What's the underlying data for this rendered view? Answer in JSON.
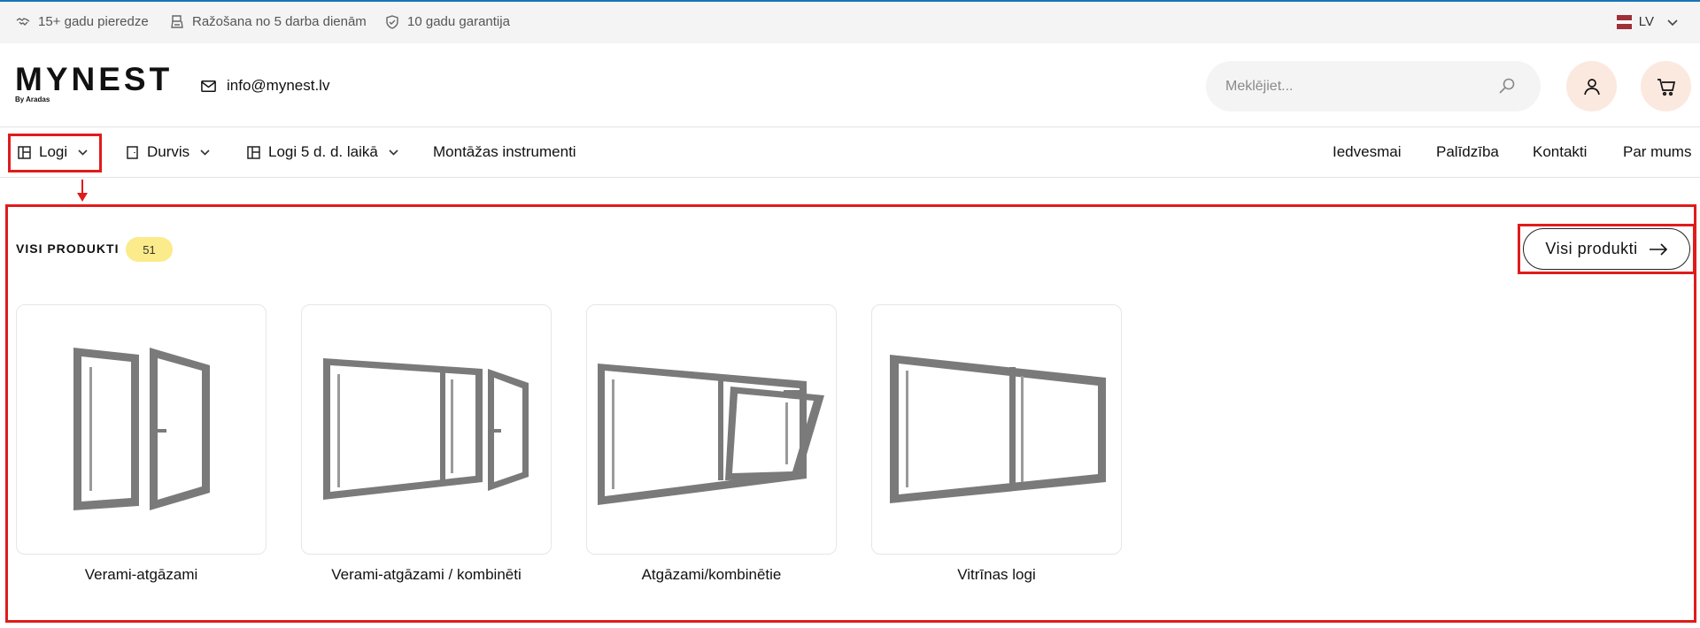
{
  "topbar": {
    "items": [
      {
        "label": "15+ gadu pieredze",
        "icon": "handshake-icon"
      },
      {
        "label": "Ražošana no 5 darba dienām",
        "icon": "timer-icon"
      },
      {
        "label": "10 gadu garantija",
        "icon": "shield-icon"
      }
    ],
    "language": "LV"
  },
  "header": {
    "logo_main": "MYNEST",
    "logo_sub": "By Aradas",
    "email": "info@mynest.lv",
    "search_placeholder": "Meklējiet..."
  },
  "nav": {
    "left": [
      {
        "label": "Logi",
        "icon": "window-icon",
        "dropdown": true
      },
      {
        "label": "Durvis",
        "icon": "door-icon",
        "dropdown": true
      },
      {
        "label": "Logi 5 d. d. laikā",
        "icon": "window-icon",
        "dropdown": true
      },
      {
        "label": "Montāžas instrumenti",
        "dropdown": false
      }
    ],
    "right": [
      "Iedvesmai",
      "Palīdzība",
      "Kontakti",
      "Par mums"
    ]
  },
  "products": {
    "title": "VISI PRODUKTI",
    "count": "51",
    "all_button": "Visi produkti",
    "categories": [
      {
        "label": "Verami-atgāzami",
        "icon": "tilt-turn-window-icon"
      },
      {
        "label": "Verami-atgāzami / kombinēti",
        "icon": "combined-window-icon"
      },
      {
        "label": "Atgāzami/kombinētie",
        "icon": "tilt-window-icon"
      },
      {
        "label": "Vitrīnas logi",
        "icon": "fixed-window-icon"
      }
    ]
  },
  "colors": {
    "annotation": "#e01b1b",
    "badge": "#fbeb8a",
    "icon_button_bg": "#fbe9df",
    "window_frame": "#7a7a7a"
  }
}
